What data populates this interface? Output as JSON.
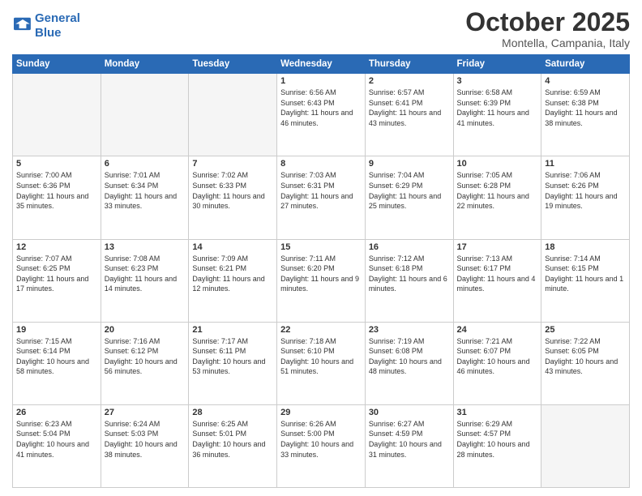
{
  "header": {
    "logo_line1": "General",
    "logo_line2": "Blue",
    "title": "October 2025",
    "subtitle": "Montella, Campania, Italy"
  },
  "days_of_week": [
    "Sunday",
    "Monday",
    "Tuesday",
    "Wednesday",
    "Thursday",
    "Friday",
    "Saturday"
  ],
  "weeks": [
    [
      {
        "day": "",
        "info": ""
      },
      {
        "day": "",
        "info": ""
      },
      {
        "day": "",
        "info": ""
      },
      {
        "day": "1",
        "info": "Sunrise: 6:56 AM\nSunset: 6:43 PM\nDaylight: 11 hours and 46 minutes."
      },
      {
        "day": "2",
        "info": "Sunrise: 6:57 AM\nSunset: 6:41 PM\nDaylight: 11 hours and 43 minutes."
      },
      {
        "day": "3",
        "info": "Sunrise: 6:58 AM\nSunset: 6:39 PM\nDaylight: 11 hours and 41 minutes."
      },
      {
        "day": "4",
        "info": "Sunrise: 6:59 AM\nSunset: 6:38 PM\nDaylight: 11 hours and 38 minutes."
      }
    ],
    [
      {
        "day": "5",
        "info": "Sunrise: 7:00 AM\nSunset: 6:36 PM\nDaylight: 11 hours and 35 minutes."
      },
      {
        "day": "6",
        "info": "Sunrise: 7:01 AM\nSunset: 6:34 PM\nDaylight: 11 hours and 33 minutes."
      },
      {
        "day": "7",
        "info": "Sunrise: 7:02 AM\nSunset: 6:33 PM\nDaylight: 11 hours and 30 minutes."
      },
      {
        "day": "8",
        "info": "Sunrise: 7:03 AM\nSunset: 6:31 PM\nDaylight: 11 hours and 27 minutes."
      },
      {
        "day": "9",
        "info": "Sunrise: 7:04 AM\nSunset: 6:29 PM\nDaylight: 11 hours and 25 minutes."
      },
      {
        "day": "10",
        "info": "Sunrise: 7:05 AM\nSunset: 6:28 PM\nDaylight: 11 hours and 22 minutes."
      },
      {
        "day": "11",
        "info": "Sunrise: 7:06 AM\nSunset: 6:26 PM\nDaylight: 11 hours and 19 minutes."
      }
    ],
    [
      {
        "day": "12",
        "info": "Sunrise: 7:07 AM\nSunset: 6:25 PM\nDaylight: 11 hours and 17 minutes."
      },
      {
        "day": "13",
        "info": "Sunrise: 7:08 AM\nSunset: 6:23 PM\nDaylight: 11 hours and 14 minutes."
      },
      {
        "day": "14",
        "info": "Sunrise: 7:09 AM\nSunset: 6:21 PM\nDaylight: 11 hours and 12 minutes."
      },
      {
        "day": "15",
        "info": "Sunrise: 7:11 AM\nSunset: 6:20 PM\nDaylight: 11 hours and 9 minutes."
      },
      {
        "day": "16",
        "info": "Sunrise: 7:12 AM\nSunset: 6:18 PM\nDaylight: 11 hours and 6 minutes."
      },
      {
        "day": "17",
        "info": "Sunrise: 7:13 AM\nSunset: 6:17 PM\nDaylight: 11 hours and 4 minutes."
      },
      {
        "day": "18",
        "info": "Sunrise: 7:14 AM\nSunset: 6:15 PM\nDaylight: 11 hours and 1 minute."
      }
    ],
    [
      {
        "day": "19",
        "info": "Sunrise: 7:15 AM\nSunset: 6:14 PM\nDaylight: 10 hours and 58 minutes."
      },
      {
        "day": "20",
        "info": "Sunrise: 7:16 AM\nSunset: 6:12 PM\nDaylight: 10 hours and 56 minutes."
      },
      {
        "day": "21",
        "info": "Sunrise: 7:17 AM\nSunset: 6:11 PM\nDaylight: 10 hours and 53 minutes."
      },
      {
        "day": "22",
        "info": "Sunrise: 7:18 AM\nSunset: 6:10 PM\nDaylight: 10 hours and 51 minutes."
      },
      {
        "day": "23",
        "info": "Sunrise: 7:19 AM\nSunset: 6:08 PM\nDaylight: 10 hours and 48 minutes."
      },
      {
        "day": "24",
        "info": "Sunrise: 7:21 AM\nSunset: 6:07 PM\nDaylight: 10 hours and 46 minutes."
      },
      {
        "day": "25",
        "info": "Sunrise: 7:22 AM\nSunset: 6:05 PM\nDaylight: 10 hours and 43 minutes."
      }
    ],
    [
      {
        "day": "26",
        "info": "Sunrise: 6:23 AM\nSunset: 5:04 PM\nDaylight: 10 hours and 41 minutes."
      },
      {
        "day": "27",
        "info": "Sunrise: 6:24 AM\nSunset: 5:03 PM\nDaylight: 10 hours and 38 minutes."
      },
      {
        "day": "28",
        "info": "Sunrise: 6:25 AM\nSunset: 5:01 PM\nDaylight: 10 hours and 36 minutes."
      },
      {
        "day": "29",
        "info": "Sunrise: 6:26 AM\nSunset: 5:00 PM\nDaylight: 10 hours and 33 minutes."
      },
      {
        "day": "30",
        "info": "Sunrise: 6:27 AM\nSunset: 4:59 PM\nDaylight: 10 hours and 31 minutes."
      },
      {
        "day": "31",
        "info": "Sunrise: 6:29 AM\nSunset: 4:57 PM\nDaylight: 10 hours and 28 minutes."
      },
      {
        "day": "",
        "info": ""
      }
    ]
  ]
}
